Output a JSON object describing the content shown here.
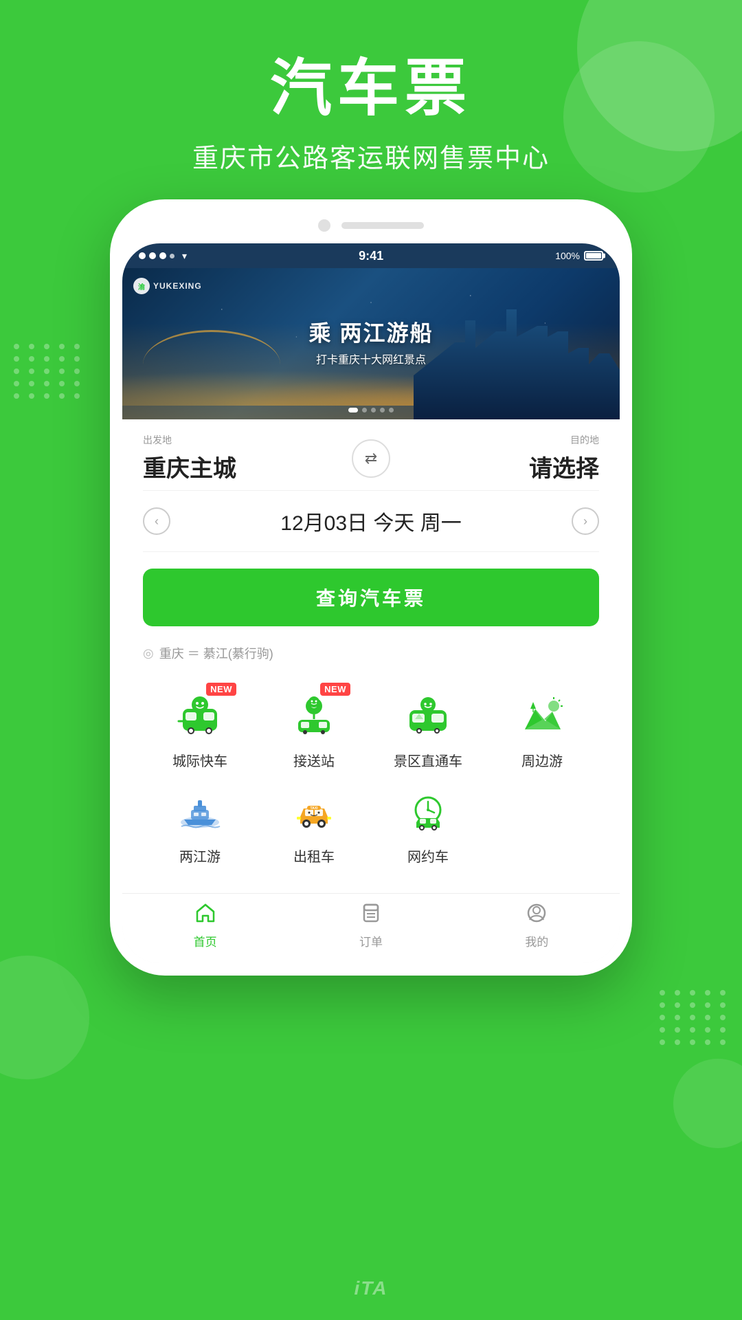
{
  "app": {
    "main_title": "汽车票",
    "sub_title": "重庆市公路客运联网售票中心"
  },
  "status_bar": {
    "dots": [
      "●",
      "●",
      "●",
      "●"
    ],
    "wifi": "WiFi",
    "time": "9:41",
    "battery_pct": "100%"
  },
  "banner": {
    "logo_text": "YUKEXING",
    "main_text": "乘 两江游船",
    "sub_text": "打卡重庆十大网红景点"
  },
  "search": {
    "from_label": "出发地",
    "from_city": "重庆主城",
    "to_label": "目的地",
    "to_city": "请选择",
    "date": "12月03日 今天 周一",
    "button_label": "查询汽车票"
  },
  "recent_route": "重庆 ＝ 綦江(綦行驹)",
  "services": [
    {
      "row": 0,
      "items": [
        {
          "id": "city-express",
          "label": "城际快车",
          "has_new": true,
          "color": "#2ec82e"
        },
        {
          "id": "pickup-station",
          "label": "接送站",
          "has_new": true,
          "color": "#2ec82e"
        },
        {
          "id": "scenic-direct",
          "label": "景区直通车",
          "has_new": false,
          "color": "#2ec82e"
        },
        {
          "id": "nearby-tour",
          "label": "周边游",
          "has_new": false,
          "color": "#2ec82e"
        }
      ]
    },
    {
      "row": 1,
      "items": [
        {
          "id": "river-tour",
          "label": "两江游",
          "has_new": false,
          "color": "#4a90d9"
        },
        {
          "id": "taxi",
          "label": "出租车",
          "has_new": false,
          "color": "#f5a623"
        },
        {
          "id": "rideshare",
          "label": "网约车",
          "has_new": false,
          "color": "#2ec82e"
        }
      ]
    }
  ],
  "bottom_nav": {
    "items": [
      {
        "id": "home",
        "label": "首页",
        "active": true
      },
      {
        "id": "orders",
        "label": "订单",
        "active": false
      },
      {
        "id": "profile",
        "label": "我的",
        "active": false
      }
    ]
  }
}
